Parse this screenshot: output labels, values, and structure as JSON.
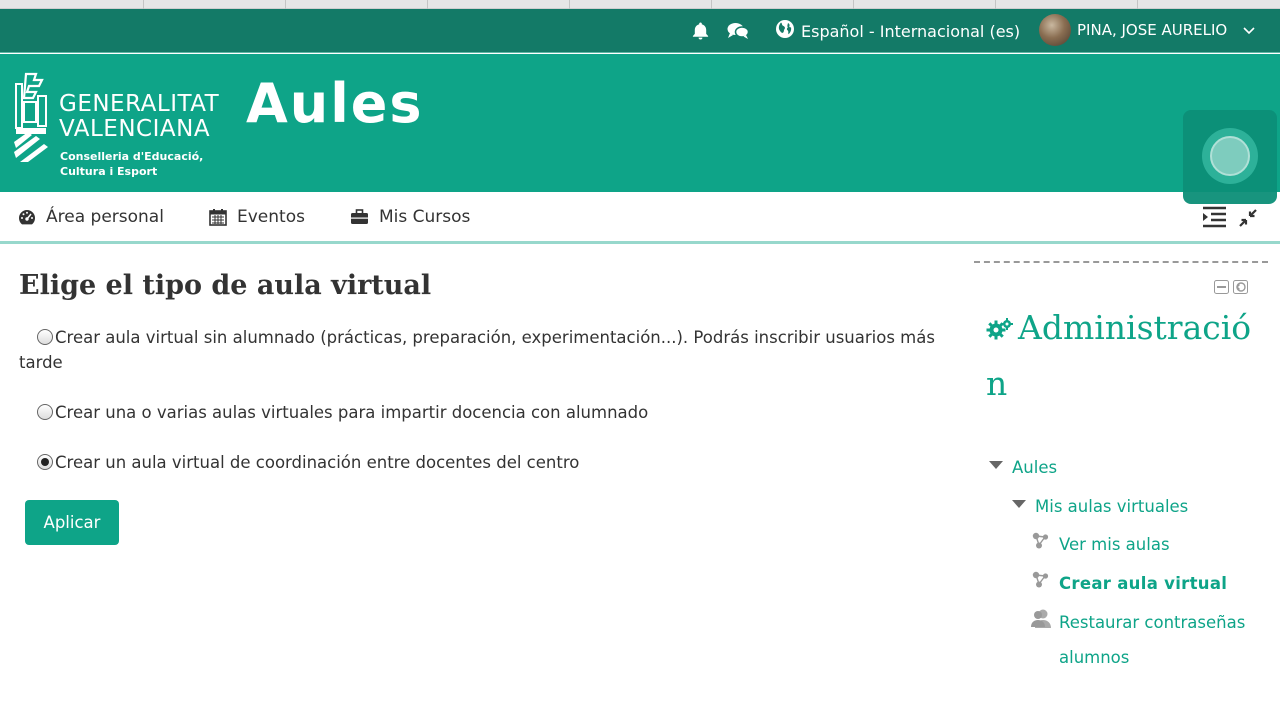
{
  "topbar": {
    "language": "Español - Internacional (es)",
    "user_name": "PINA, JOSE AURELIO"
  },
  "header": {
    "org_line1": "GENERALITAT",
    "org_line2": "VALENCIANA",
    "org_sub1": "Conselleria d'Educació,",
    "org_sub2": "Cultura i Esport",
    "site_name": "Aules"
  },
  "nav": {
    "items": [
      {
        "label": "Área personal",
        "icon": "dashboard-icon"
      },
      {
        "label": "Eventos",
        "icon": "calendar-icon"
      },
      {
        "label": "Mis Cursos",
        "icon": "briefcase-icon"
      }
    ]
  },
  "main": {
    "title": "Elige el tipo de aula virtual",
    "options": [
      {
        "label": "Crear aula virtual sin alumnado (prácticas, preparación, experimentación...). Podrás inscribir usuarios más tarde",
        "checked": false
      },
      {
        "label": "Crear una o varias aulas virtuales para impartir docencia con alumnado",
        "checked": false
      },
      {
        "label": "Crear un aula virtual de coordinación entre docentes del centro",
        "checked": true
      }
    ],
    "apply_label": "Aplicar"
  },
  "sidebar": {
    "title": "Administración",
    "tree": [
      {
        "label": "Aules",
        "icon": "expanded-triangle-icon"
      },
      {
        "label": "Mis aulas virtuales",
        "icon": "expanded-triangle-icon"
      },
      {
        "label": "Ver mis aulas",
        "icon": "molecule-icon"
      },
      {
        "label": "Crear aula virtual",
        "icon": "molecule-icon",
        "active": true
      },
      {
        "label": "Restaurar contraseñas alumnos",
        "icon": "users-icon"
      }
    ]
  },
  "colors": {
    "brand": "#0ea488",
    "topbar": "#137a67"
  }
}
